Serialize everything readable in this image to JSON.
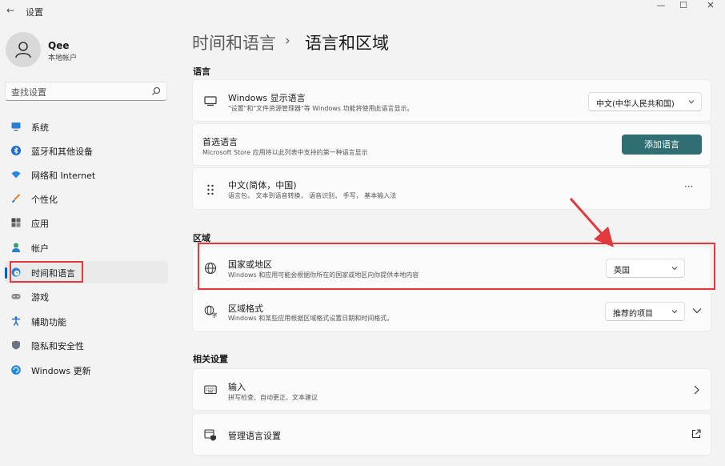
{
  "window": {
    "title": "设置",
    "back_glyph": "←",
    "minimize_glyph": "—",
    "maximize_glyph": "☐",
    "close_glyph": "✕"
  },
  "user": {
    "name": "Qee",
    "account_type": "本地帐户"
  },
  "search": {
    "placeholder": "查找设置"
  },
  "sidebar": {
    "items": [
      {
        "label": "系统",
        "icon": "monitor-icon"
      },
      {
        "label": "蓝牙和其他设备",
        "icon": "bluetooth-icon"
      },
      {
        "label": "网络和 Internet",
        "icon": "wifi-icon"
      },
      {
        "label": "个性化",
        "icon": "brush-icon"
      },
      {
        "label": "应用",
        "icon": "apps-icon"
      },
      {
        "label": "帐户",
        "icon": "person-icon"
      },
      {
        "label": "时间和语言",
        "icon": "globe-clock-icon",
        "active": true
      },
      {
        "label": "游戏",
        "icon": "gamepad-icon"
      },
      {
        "label": "辅助功能",
        "icon": "accessibility-icon"
      },
      {
        "label": "隐私和安全性",
        "icon": "shield-icon"
      },
      {
        "label": "Windows 更新",
        "icon": "update-icon"
      }
    ]
  },
  "breadcrumb": {
    "parent": "时间和语言",
    "separator": "›",
    "current": "语言和区域"
  },
  "language_section": {
    "title": "语言",
    "display_language": {
      "title": "Windows 显示语言",
      "desc": "\"设置\"和\"文件资源管理器\"等 Windows 功能将使用此语言显示。",
      "value": "中文(中华人民共和国)"
    },
    "preferred": {
      "title": "首选语言",
      "desc": "Microsoft Store 应用将以此列表中支持的第一种语言显示",
      "button": "添加语言"
    },
    "chinese": {
      "title": "中文(简体，中国)",
      "desc": "语言包， 文本到语音转换， 语音识别， 手写， 基本输入法",
      "more": "···"
    }
  },
  "region_section": {
    "title": "区域",
    "country": {
      "title": "国家或地区",
      "desc": "Windows 和应用可能会根据你所在的国家或地区向你提供本地内容",
      "value": "英国"
    },
    "format": {
      "title": "区域格式",
      "desc": "Windows 和某些应用根据区域格式设置日期和时间格式。",
      "value": "推荐的项目"
    }
  },
  "related_section": {
    "title": "相关设置",
    "input": {
      "title": "输入",
      "desc": "拼写检查、自动更正、文本建议"
    },
    "manage": {
      "title": "管理语言设置"
    }
  },
  "colors": {
    "accent": "#005fb8",
    "primary_button": "#2f6f73",
    "annotation": "#e03a3e"
  }
}
